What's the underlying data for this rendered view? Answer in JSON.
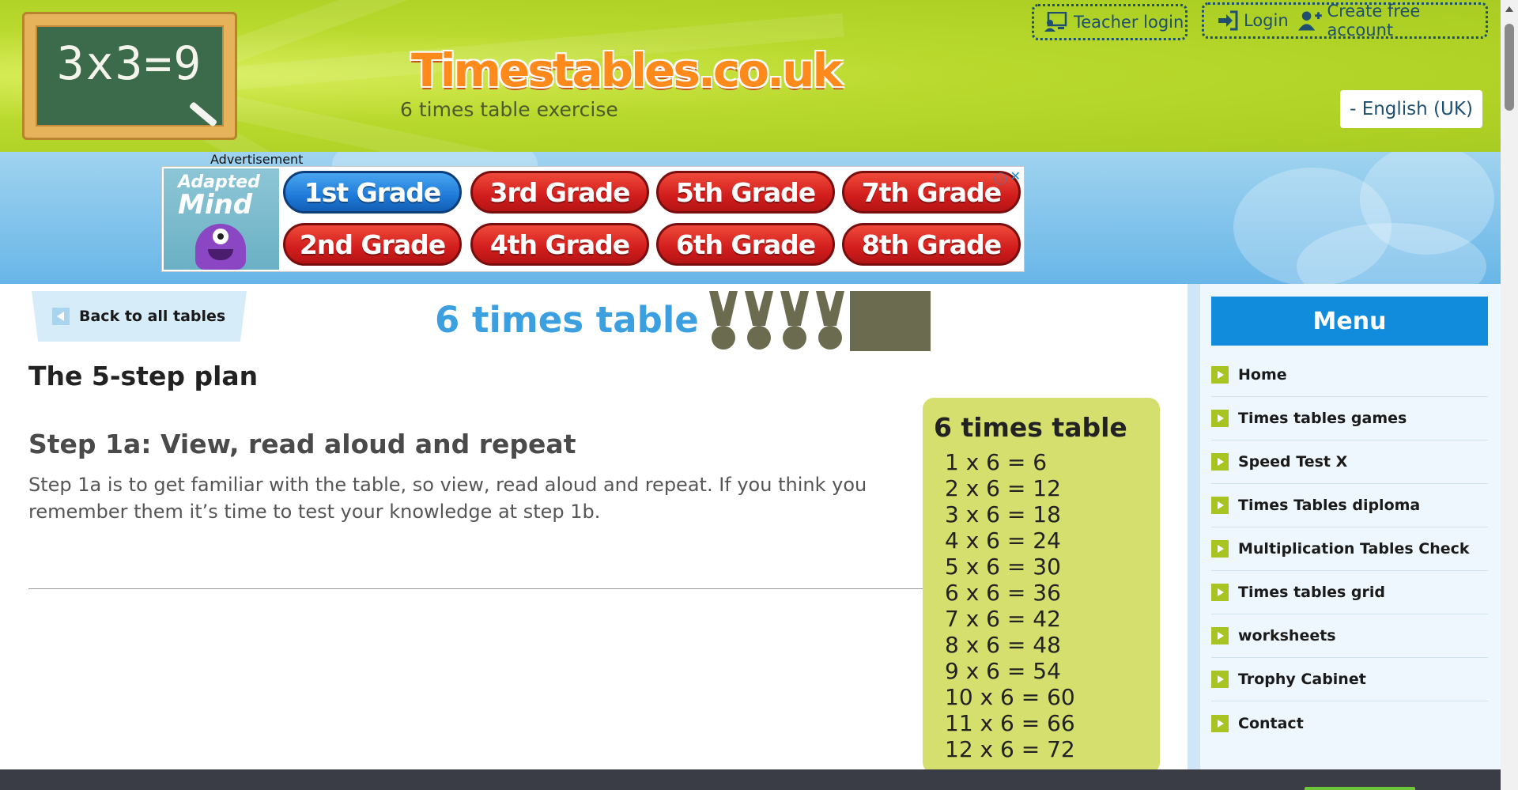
{
  "header": {
    "logo_board_text": "3x3=9",
    "site_name": "Timestables.co.uk",
    "subtitle": "6 times table exercise",
    "teacher_login": "Teacher login",
    "login": "Login",
    "create_account": "Create free account",
    "language": "- English (UK)"
  },
  "ad": {
    "label": "Advertisement",
    "brand_line1": "Adapted",
    "brand_line2": "Mind",
    "grades": [
      "1st Grade",
      "3rd Grade",
      "5th Grade",
      "7th Grade",
      "2nd Grade",
      "4th Grade",
      "6th Grade",
      "8th Grade"
    ],
    "highlighted_grade": "1st Grade",
    "info_glyph": "ⓘ",
    "close_glyph": "✕"
  },
  "main": {
    "back_label": "Back to all tables",
    "title": "6 times table",
    "medals_earned": 4,
    "plan_heading": "The 5-step plan",
    "step_heading": "Step 1a: View, read aloud and repeat",
    "step_text": "Step 1a is to get familiar with the table, so view, read aloud and repeat. If you think you remember them it’s time to test your knowledge at step 1b."
  },
  "table_card": {
    "title": "6 times table",
    "rows": [
      "1 x 6 = 6",
      "2 x 6 = 12",
      "3 x 6 = 18",
      "4 x 6 = 24",
      "5 x 6 = 30",
      "6 x 6 = 36",
      "7 x 6 = 42",
      "8 x 6 = 48",
      "9 x 6 = 54",
      "10 x 6 = 60",
      "11 x 6 = 66",
      "12 x 6 = 72"
    ]
  },
  "sidebar": {
    "menu_title": "Menu",
    "items": [
      "Home",
      "Times tables games",
      "Speed Test X",
      "Times Tables diploma",
      "Multiplication Tables Check",
      "Times tables grid",
      "worksheets",
      "Trophy Cabinet",
      "Contact"
    ]
  },
  "colors": {
    "header_green": "#b8d82c",
    "title_blue": "#3b9fe0",
    "menu_blue": "#118bdc",
    "card_green": "#d5df6e",
    "ad_red": "#d21d1d"
  }
}
